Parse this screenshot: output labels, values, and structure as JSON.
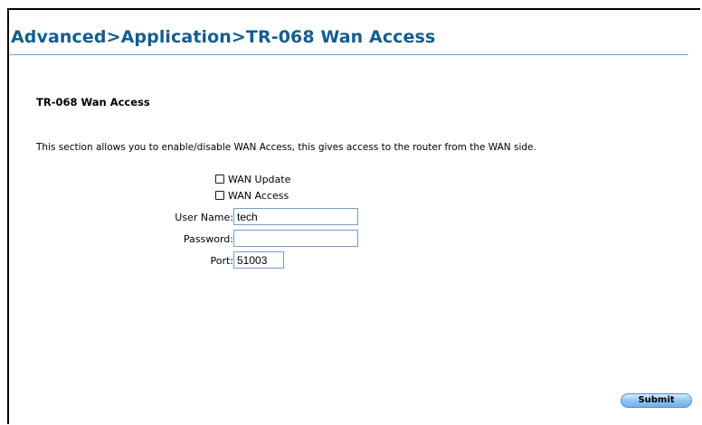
{
  "header": {
    "breadcrumb_title": "Advanced>Application>TR-068 Wan Access"
  },
  "section": {
    "heading": "TR-068 Wan Access",
    "description": "This section allows you to enable/disable WAN Access, this gives access to the router from the WAN side."
  },
  "form": {
    "wan_update": {
      "label": "WAN Update",
      "checked": false
    },
    "wan_access": {
      "label": "WAN Access",
      "checked": false
    },
    "username": {
      "label": "User Name:",
      "value": "tech"
    },
    "password": {
      "label": "Password:",
      "value": ""
    },
    "port": {
      "label": "Port:",
      "value": "51003"
    },
    "submit_label": "Submit"
  },
  "colors": {
    "title": "#135d8e",
    "rule": "#6aa9c9",
    "button": "#8fc6f3"
  }
}
